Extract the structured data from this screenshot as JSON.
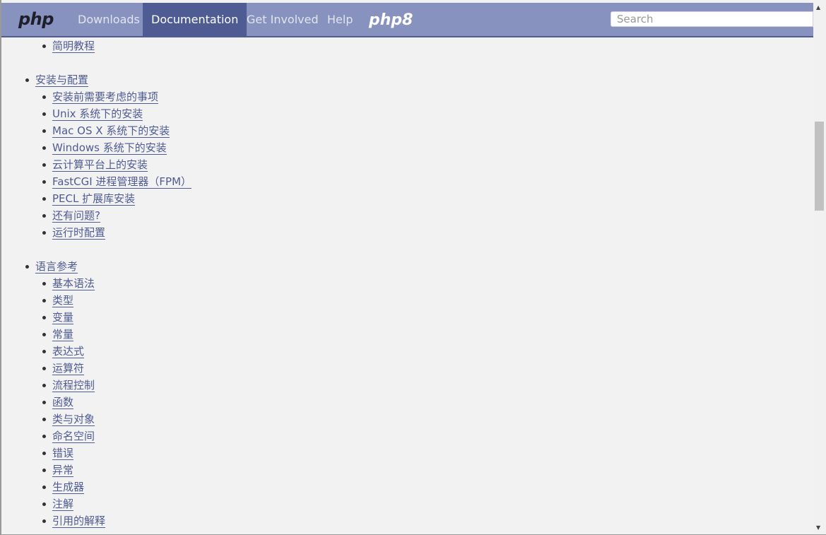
{
  "header": {
    "logo_text": "php",
    "nav": [
      {
        "label": "Downloads"
      },
      {
        "label": "Documentation"
      },
      {
        "label": "Get Involved"
      },
      {
        "label": "Help"
      }
    ],
    "php8_badge": "php8",
    "search_placeholder": "Search"
  },
  "content": {
    "top_item": "简明教程",
    "install": {
      "title": "安装与配置",
      "items": [
        "安装前需要考虑的事项",
        "Unix 系统下的安装",
        "Mac OS X 系统下的安装",
        "Windows 系统下的安装",
        "云计算平台上的安装",
        "FastCGI 进程管理器（FPM）",
        "PECL 扩展库安装",
        "还有问题?",
        "运行时配置"
      ]
    },
    "lang": {
      "title": "语言参考",
      "items": [
        "基本语法",
        "类型",
        "变量",
        "常量",
        "表达式",
        "运算符",
        "流程控制",
        "函数",
        "类与对象",
        "命名空间",
        "错误",
        "异常",
        "生成器",
        "注解",
        "引用的解释"
      ]
    }
  }
}
